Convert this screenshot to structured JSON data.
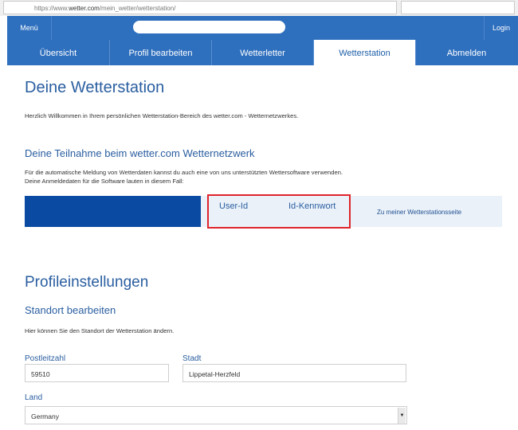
{
  "browser": {
    "url_prefix": "https://www.",
    "url_host": "wetter.com",
    "url_path": "/mein_wetter/wetterstation/"
  },
  "topbar": {
    "menu_label": "Menü",
    "login_label": "Login"
  },
  "tabs": [
    {
      "label": "Übersicht",
      "active": false
    },
    {
      "label": "Profil bearbeiten",
      "active": false
    },
    {
      "label": "Wetterletter",
      "active": false
    },
    {
      "label": "Wetterstation",
      "active": true
    },
    {
      "label": "Abmelden",
      "active": false
    }
  ],
  "main": {
    "title": "Deine Wetterstation",
    "welcome": "Herzlich Willkommen in Ihrem persönlichen Wetterstation-Bereich des wetter.com - Wetternetzwerkes.",
    "participation_title": "Deine Teilnahme beim wetter.com Wetternetzwerk",
    "participation_text_1": "Für die automatische Meldung von Wetterdaten kannst du auch eine von uns unterstützten Wettersoftware verwenden.",
    "participation_text_2": "Deine Anmeldedaten für die Software lauten in diesem Fall:",
    "user_id_label": "User-Id",
    "password_label": "Id-Kennwort",
    "station_link": "Zu meiner Wetterstationsseite"
  },
  "profile": {
    "title": "Profileinstellungen",
    "location_title": "Standort bearbeiten",
    "location_text": "Hier können Sie den Standort der Wetterstation ändern.",
    "postcode_label": "Postleitzahl",
    "postcode_value": "59510",
    "city_label": "Stadt",
    "city_value": "Lippetal-Herzfeld",
    "country_label": "Land",
    "country_value": "Germany"
  },
  "colors": {
    "nav_blue": "#2e6fbe",
    "heading_blue": "#2a5ea0",
    "cred_blue": "#0b4aa2",
    "highlight_red": "#e0242b"
  }
}
